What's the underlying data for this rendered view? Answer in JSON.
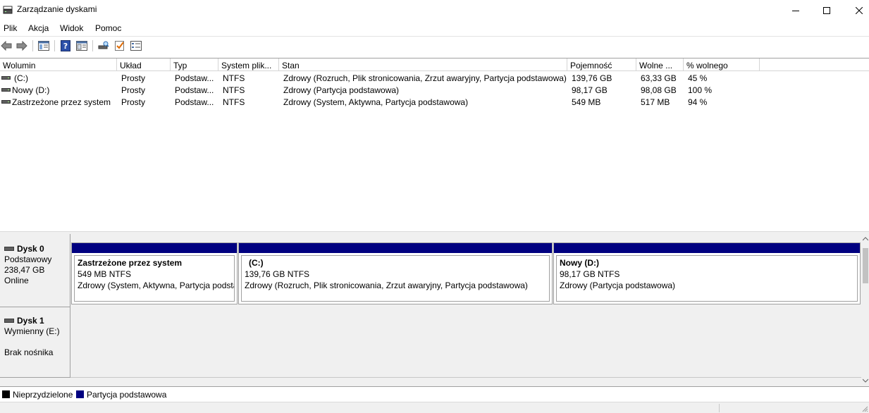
{
  "window": {
    "title": "Zarządzanie dyskami",
    "icon": "disk-management-icon"
  },
  "menu": [
    "Plik",
    "Akcja",
    "Widok",
    "Pomoc"
  ],
  "toolbar": {
    "buttons": [
      "back-icon",
      "forward-icon",
      "console-tree-icon",
      "help-icon",
      "properties-icon",
      "rescan-disks-icon",
      "check-icon",
      "list-view-icon"
    ]
  },
  "volume_list": {
    "columns": [
      "Wolumin",
      "Układ",
      "Typ",
      "System plik...",
      "Stan",
      "Pojemność",
      "Wolne ...",
      "% wolnego"
    ],
    "rows": [
      [
        "(C:)",
        "Prosty",
        "Podstaw...",
        "NTFS",
        "Zdrowy (Rozruch, Plik stronicowania, Zrzut awaryjny, Partycja podstawowa)",
        "139,76 GB",
        "63,33 GB",
        "45 %"
      ],
      [
        "Nowy (D:)",
        "Prosty",
        "Podstaw...",
        "NTFS",
        "Zdrowy (Partycja podstawowa)",
        "98,17 GB",
        "98,08 GB",
        "100 %"
      ],
      [
        "Zastrzeżone przez system",
        "Prosty",
        "Podstaw...",
        "NTFS",
        "Zdrowy (System, Aktywna, Partycja podstawowa)",
        "549 MB",
        "517 MB",
        "94 %"
      ]
    ]
  },
  "disks": [
    {
      "name": "Dysk 0",
      "lines": [
        "Podstawowy",
        "238,47 GB",
        "Online"
      ],
      "partitions": [
        {
          "name": "Zastrzeżone przez system",
          "size": "549 MB NTFS",
          "status": "Zdrowy (System, Aktywna, Partycja podstawowa)"
        },
        {
          "name": "(C:)",
          "size": "139,76 GB NTFS",
          "status": "Zdrowy (Rozruch, Plik stronicowania, Zrzut awaryjny, Partycja podstawowa)"
        },
        {
          "name": "Nowy  (D:)",
          "size": "98,17 GB NTFS",
          "status": "Zdrowy (Partycja podstawowa)"
        }
      ]
    },
    {
      "name": "Dysk 1",
      "lines": [
        "Wymienny (E:)",
        "",
        "Brak nośnika"
      ]
    }
  ],
  "legend": [
    {
      "label": "Nieprzydzielone",
      "color": "#000000"
    },
    {
      "label": "Partycja podstawowa",
      "color": "#000080"
    }
  ],
  "colors": {
    "primary_partition": "#000080",
    "unallocated": "#000000"
  }
}
